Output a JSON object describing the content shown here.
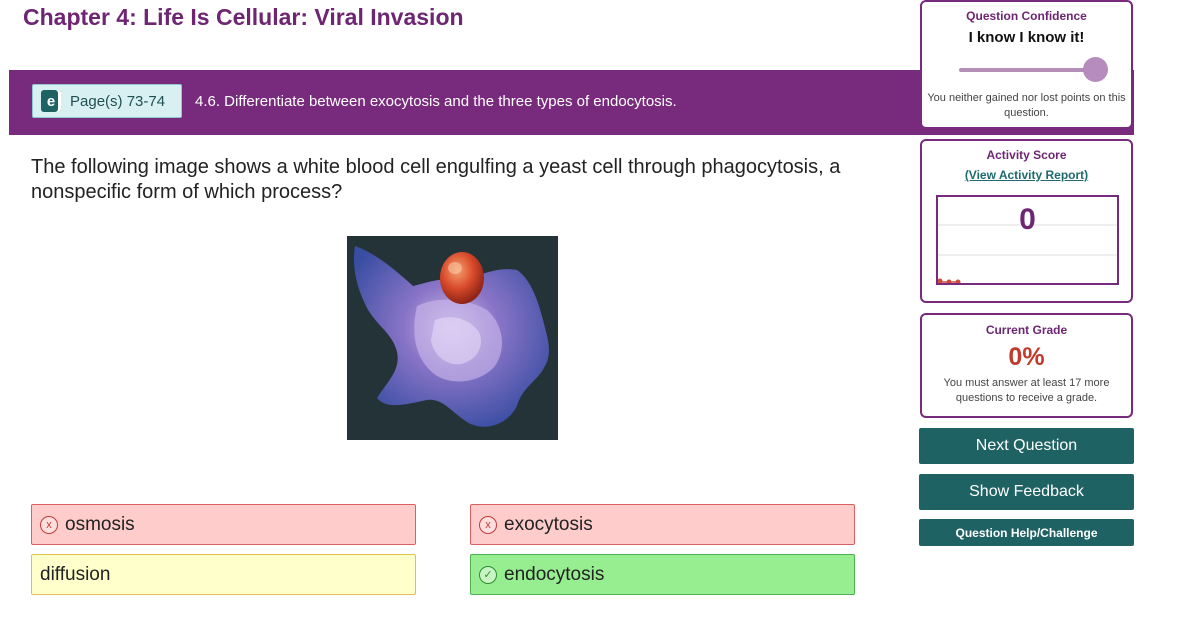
{
  "chapter": {
    "title": "Chapter 4: Life Is Cellular: Viral Invasion"
  },
  "banner": {
    "ebook_icon_glyph": "e",
    "pages_label": "Page(s) 73-74",
    "objective": "4.6. Differentiate between exocytosis and the three types of endocytosis."
  },
  "question": {
    "text": "The following image shows a white blood cell engulfing a yeast cell through phagocytosis, a nonspecific form of which process?"
  },
  "answers": [
    {
      "label": "osmosis",
      "state": "incorrect",
      "mark": "x"
    },
    {
      "label": "exocytosis",
      "state": "incorrect",
      "mark": "x"
    },
    {
      "label": "diffusion",
      "state": "neutral"
    },
    {
      "label": "endocytosis",
      "state": "correct",
      "mark": "✓"
    }
  ],
  "confidence": {
    "heading": "Question Confidence",
    "value": "I know I know it!",
    "slider_level": 1.0,
    "note": "You neither gained nor lost points on this question."
  },
  "activity": {
    "heading": "Activity Score",
    "report_link": "(View Activity Report)",
    "score": "0"
  },
  "grade": {
    "heading": "Current Grade",
    "value": "0%",
    "note": "You must answer at least 17 more questions to receive a grade."
  },
  "buttons": {
    "next": "Next Question",
    "feedback": "Show Feedback",
    "help": "Question Help/Challenge"
  },
  "colors": {
    "brand_purple": "#782a7c",
    "teal": "#1f6264",
    "incorrect_bg": "#ffcccc",
    "neutral_bg": "#ffffcc",
    "correct_bg": "#97ee91",
    "grade_red": "#c23a2c"
  }
}
